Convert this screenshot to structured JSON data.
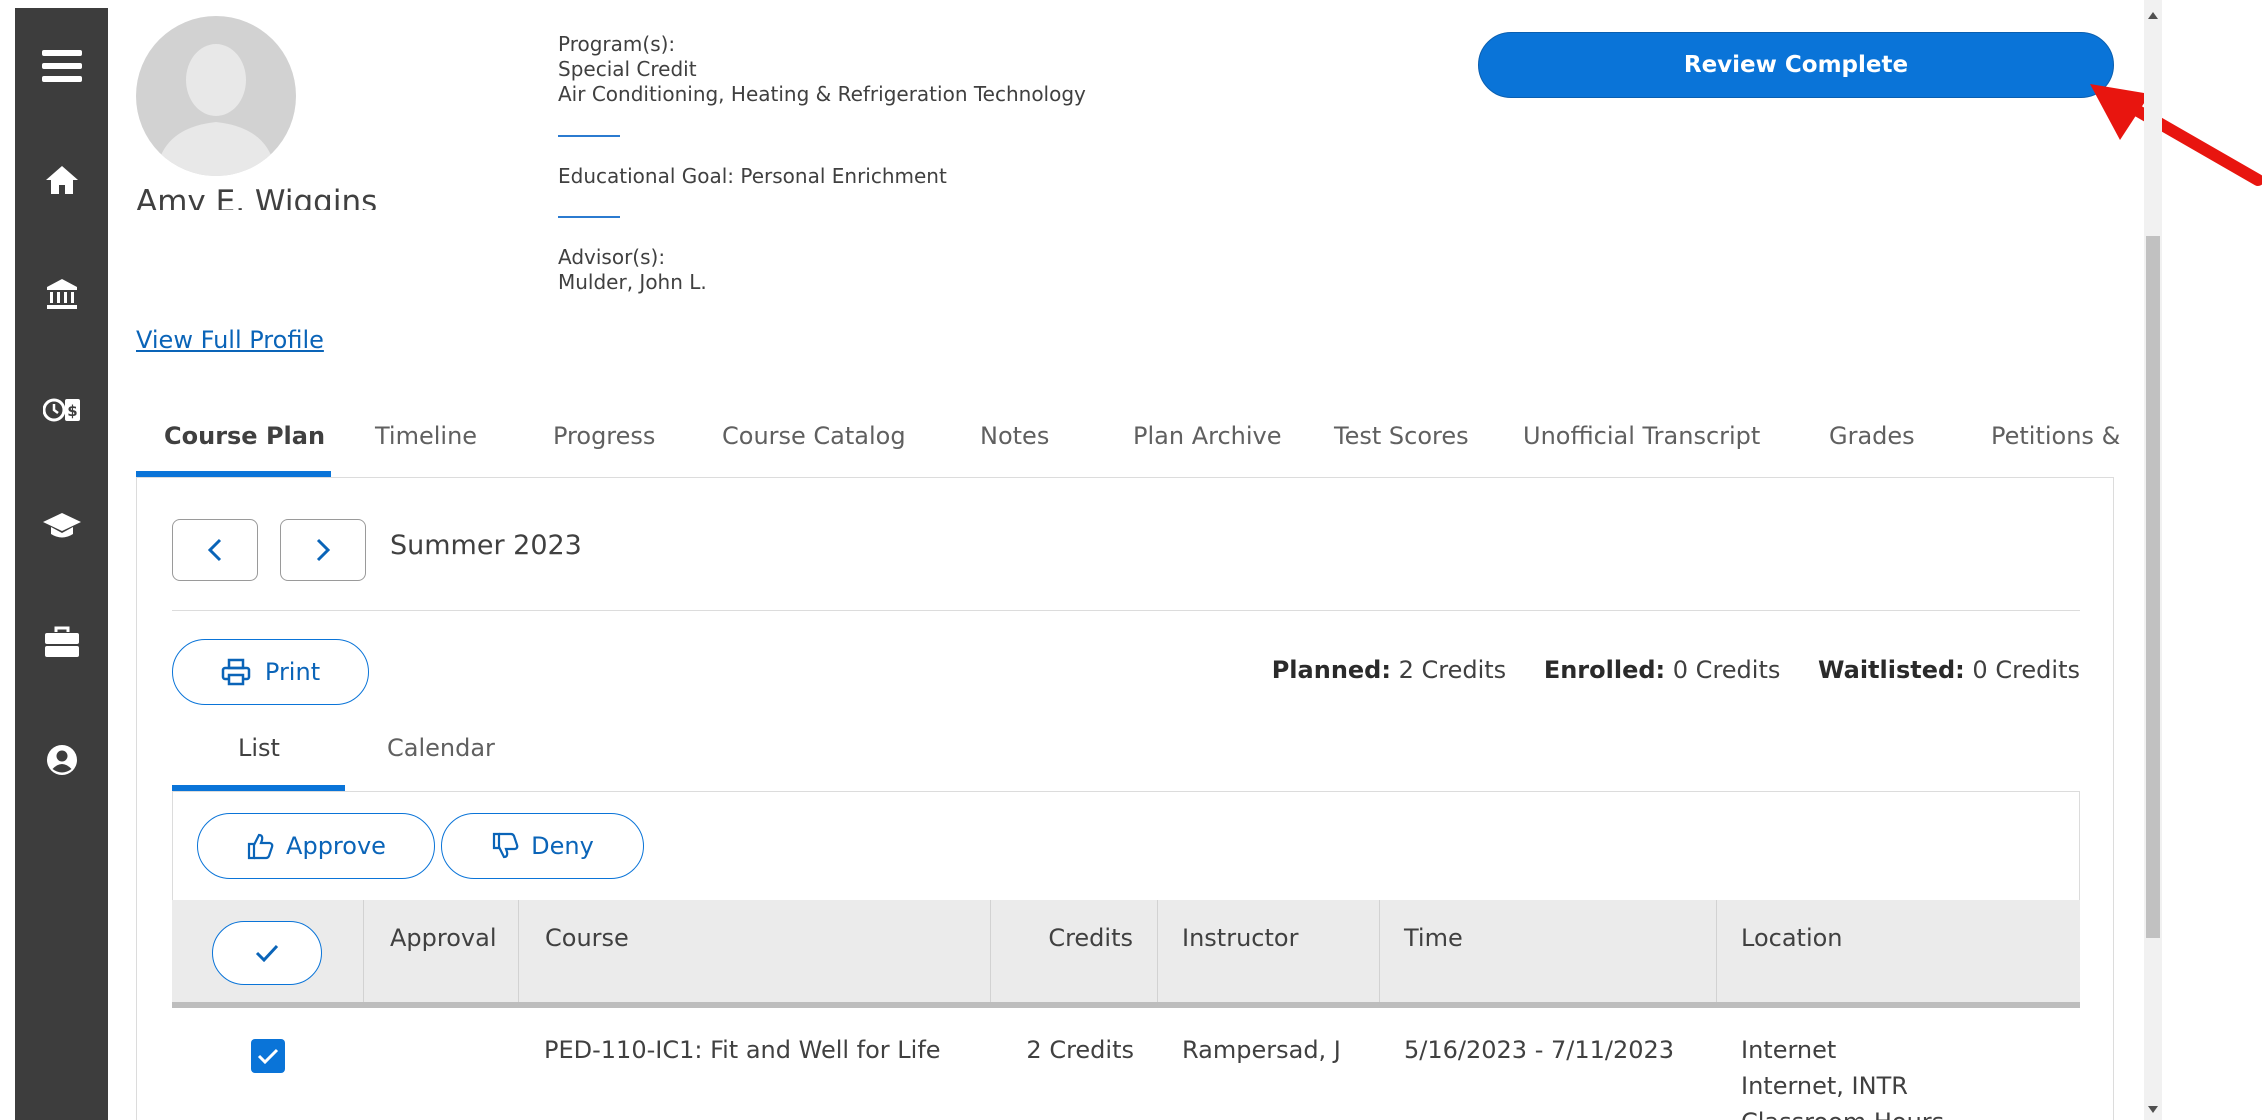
{
  "student": {
    "name": "Amy E. Wiggins",
    "programs_label": "Program(s):",
    "programs": [
      "Special Credit",
      "Air Conditioning, Heating & Refrigeration Technology"
    ],
    "goal": "Educational Goal: Personal Enrichment",
    "advisors_label": "Advisor(s):",
    "advisor": "Mulder, John L.",
    "view_profile": "View Full Profile"
  },
  "review_button": "Review Complete",
  "tabs": [
    "Course Plan",
    "Timeline",
    "Progress",
    "Course Catalog",
    "Notes",
    "Plan Archive",
    "Test Scores",
    "Unofficial Transcript",
    "Grades",
    "Petitions &"
  ],
  "term": "Summer 2023",
  "print_label": "Print",
  "summary": {
    "planned_label": "Planned:",
    "planned_value": "2 Credits",
    "enrolled_label": "Enrolled:",
    "enrolled_value": "0 Credits",
    "waitlisted_label": "Waitlisted:",
    "waitlisted_value": "0 Credits"
  },
  "subtabs": [
    "List",
    "Calendar"
  ],
  "actions": {
    "approve": "Approve",
    "deny": "Deny"
  },
  "table": {
    "headers": {
      "approval": "Approval",
      "course": "Course",
      "credits": "Credits",
      "instructor": "Instructor",
      "time": "Time",
      "location": "Location"
    },
    "rows": [
      {
        "course": "PED-110-IC1: Fit and Well for Life",
        "credits": "2 Credits",
        "instructor": "Rampersad, J",
        "time": "5/16/2023 - 7/11/2023",
        "location": [
          "Internet",
          "Internet, INTR",
          "Classroom Hours"
        ]
      }
    ]
  },
  "colors": {
    "accent": "#0a74d8",
    "sidebar": "#3d3d3d",
    "annotation_arrow": "#e8150f"
  },
  "icons": [
    "menu-icon",
    "home-icon",
    "bank-icon",
    "financial-aid-icon",
    "graduation-cap-icon",
    "briefcase-icon",
    "user-circle-icon",
    "printer-icon",
    "thumbs-up-icon",
    "thumbs-down-icon",
    "checkmark-icon",
    "chevron-left-icon",
    "chevron-right-icon"
  ]
}
